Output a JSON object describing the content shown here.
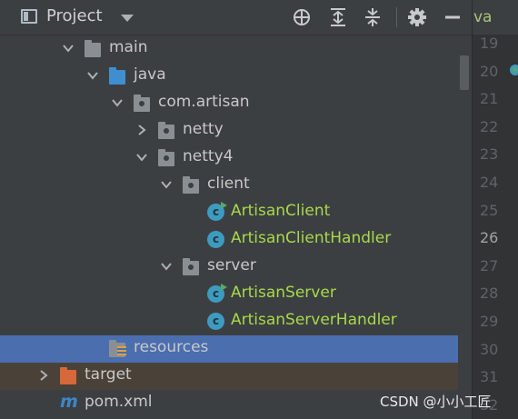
{
  "header": {
    "title": "Project",
    "actions": [
      "locate-icon",
      "expand-all-icon",
      "collapse-all-icon",
      "settings-icon",
      "hide-icon"
    ]
  },
  "tree": [
    {
      "label": "main",
      "depth": 3,
      "icon": "folder-icon",
      "arrow": "expanded"
    },
    {
      "label": "java",
      "depth": 4,
      "icon": "source-folder-icon",
      "arrow": "expanded"
    },
    {
      "label": "com.artisan",
      "depth": 5,
      "icon": "package-icon",
      "arrow": "expanded"
    },
    {
      "label": "netty",
      "depth": 6,
      "icon": "package-icon",
      "arrow": "collapsed"
    },
    {
      "label": "netty4",
      "depth": 6,
      "icon": "package-icon",
      "arrow": "expanded"
    },
    {
      "label": "client",
      "depth": 7,
      "icon": "package-icon",
      "arrow": "expanded"
    },
    {
      "label": "ArtisanClient",
      "depth": 8,
      "icon": "runnable-class-icon",
      "arrow": "none"
    },
    {
      "label": "ArtisanClientHandler",
      "depth": 8,
      "icon": "class-icon",
      "arrow": "none"
    },
    {
      "label": "server",
      "depth": 7,
      "icon": "package-icon",
      "arrow": "expanded"
    },
    {
      "label": "ArtisanServer",
      "depth": 8,
      "icon": "runnable-class-icon",
      "arrow": "none"
    },
    {
      "label": "ArtisanServerHandler",
      "depth": 8,
      "icon": "class-icon",
      "arrow": "none"
    },
    {
      "label": "resources",
      "depth": 4,
      "icon": "resources-folder-icon",
      "arrow": "none",
      "selected": true
    },
    {
      "label": "target",
      "depth": 2,
      "icon": "excluded-folder-icon",
      "arrow": "collapsed",
      "excluded": true
    },
    {
      "label": "pom.xml",
      "depth": 2,
      "icon": "maven-icon",
      "arrow": "none"
    }
  ],
  "editor": {
    "tab_label": "va",
    "line_numbers": [
      "19",
      "20",
      "21",
      "22",
      "23",
      "24",
      "25",
      "26",
      "27",
      "28",
      "29",
      "30",
      "31",
      "32"
    ],
    "current_line": "26"
  },
  "watermark": "CSDN @小小工匠",
  "colors": {
    "panel_bg": "#3c3f41",
    "selected_bg": "#4b6eaf",
    "excluded_bg": "#4a4238",
    "class_text": "#a8d84b",
    "class_icon": "#3d9bbf"
  }
}
